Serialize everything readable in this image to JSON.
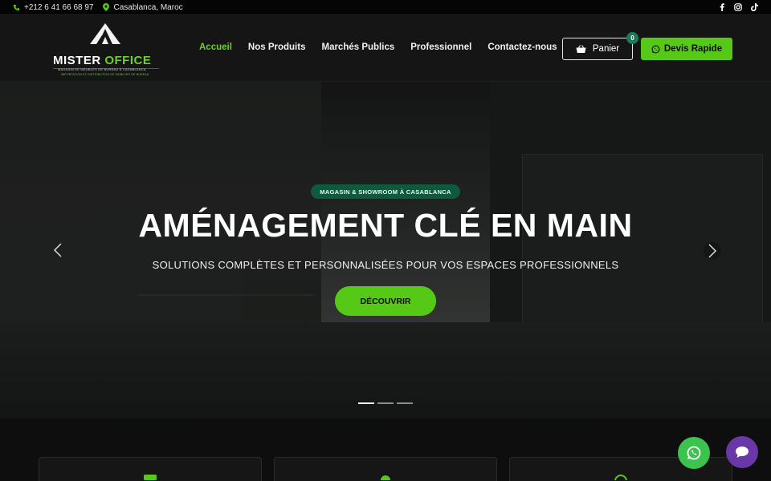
{
  "topbar": {
    "phone": "+212 6 41 66 68 97",
    "location": "Casablanca, Maroc",
    "social": [
      "facebook-icon",
      "instagram-icon",
      "tiktok-icon"
    ]
  },
  "logo": {
    "brand_main": "MISTER",
    "brand_accent": "OFFICE",
    "tagline_1": "MAGASIN DE MEUBLES DE BUREAU À CASABLANCA",
    "tagline_2": "IMPORTATION ET DISTRIBUTION DE MOBILIER DE BUREAU"
  },
  "nav": {
    "items": [
      {
        "label": "Accueil"
      },
      {
        "label": "Nos Produits"
      },
      {
        "label": "Marchés Publics"
      },
      {
        "label": "Professionnel"
      },
      {
        "label": "Contactez-nous"
      }
    ]
  },
  "cart": {
    "label": "Panier",
    "count": "0"
  },
  "quote": {
    "label": "Devis Rapide"
  },
  "hero": {
    "badge": "MAGASIN & SHOWROOM À CASABLANCA",
    "title": "AMÉNAGEMENT CLÉ EN MAIN",
    "subtitle": "SOLUTIONS COMPLÈTES ET PERSONNALISÉES POUR VOS ESPACES PROFESSIONNELS",
    "button": "DÉCOUVRIR",
    "slides": 3,
    "active_slide": 1
  },
  "colors": {
    "accent": "#56c816",
    "badge_bg": "#0f5a3f",
    "header_bg": "#151515",
    "whatsapp": "#3cc24e",
    "chat": "#6a37a8"
  }
}
